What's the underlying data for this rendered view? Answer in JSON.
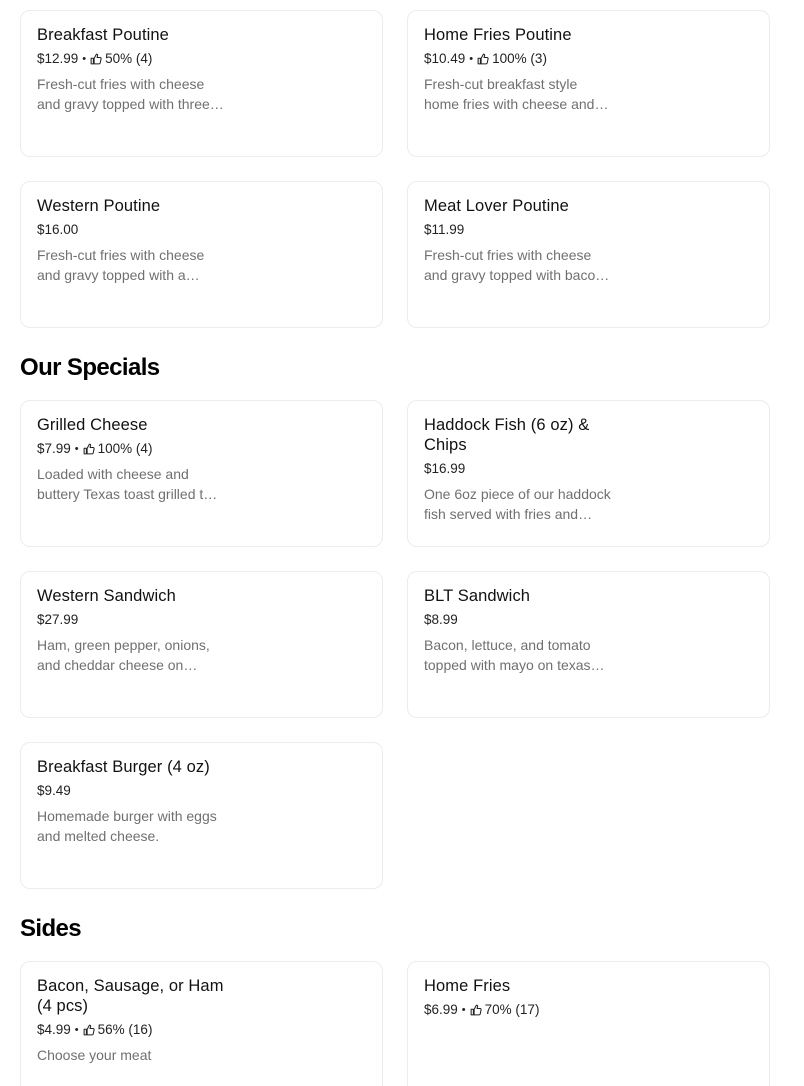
{
  "sections": {
    "specials": "Our Specials",
    "sides": "Sides"
  },
  "items": {
    "breakfast_poutine": {
      "name": "Breakfast Poutine",
      "price": "$12.99",
      "rating": "50% (4)",
      "desc": "Fresh-cut fries with cheese and gravy topped with three eggs, bacon and sausage"
    },
    "home_fries_poutine": {
      "name": "Home Fries Poutine",
      "price": "$10.49",
      "rating": "100% (3)",
      "desc": "Fresh-cut breakfast style home fries with cheese and gravy"
    },
    "western_poutine": {
      "name": "Western Poutine",
      "price": "$16.00",
      "desc": "Fresh-cut fries with cheese and gravy topped with a western omelette"
    },
    "meat_lover_poutine": {
      "name": "Meat Lover Poutine",
      "price": "$11.99",
      "desc": "Fresh-cut fries with cheese and gravy topped with bacon, sausage and ham"
    },
    "grilled_cheese": {
      "name": "Grilled Cheese",
      "price": "$7.99",
      "rating": "100% (4)",
      "desc": "Loaded with cheese and buttery Texas toast grilled to perfection"
    },
    "haddock_fish": {
      "name": "Haddock Fish (6 oz) & Chips",
      "price": "$16.99",
      "desc": "One 6oz piece of our haddock fish served with fries and coleslaw"
    },
    "western_sandwich": {
      "name": "Western Sandwich",
      "price": "$27.99",
      "desc": "Ham, green pepper, onions, and cheddar cheese on toasted bread"
    },
    "blt_sandwich": {
      "name": "BLT Sandwich",
      "price": "$8.99",
      "desc": "Bacon, lettuce, and tomato topped with mayo on texas toast"
    },
    "breakfast_burger": {
      "name": "Breakfast Burger (4 oz)",
      "price": "$9.49",
      "desc": "Homemade burger with eggs and melted cheese."
    },
    "bacon_sausage_ham": {
      "name": "Bacon, Sausage, or Ham (4 pcs)",
      "price": "$4.99",
      "rating": "56% (16)",
      "desc": "Choose your meat"
    },
    "home_fries": {
      "name": "Home Fries",
      "price": "$6.99",
      "rating": "70% (17)"
    }
  },
  "icons": {
    "rating": "thumbs-up-icon"
  },
  "colors": {
    "text": "#000000",
    "muted": "#707070",
    "border": "#ececec"
  }
}
